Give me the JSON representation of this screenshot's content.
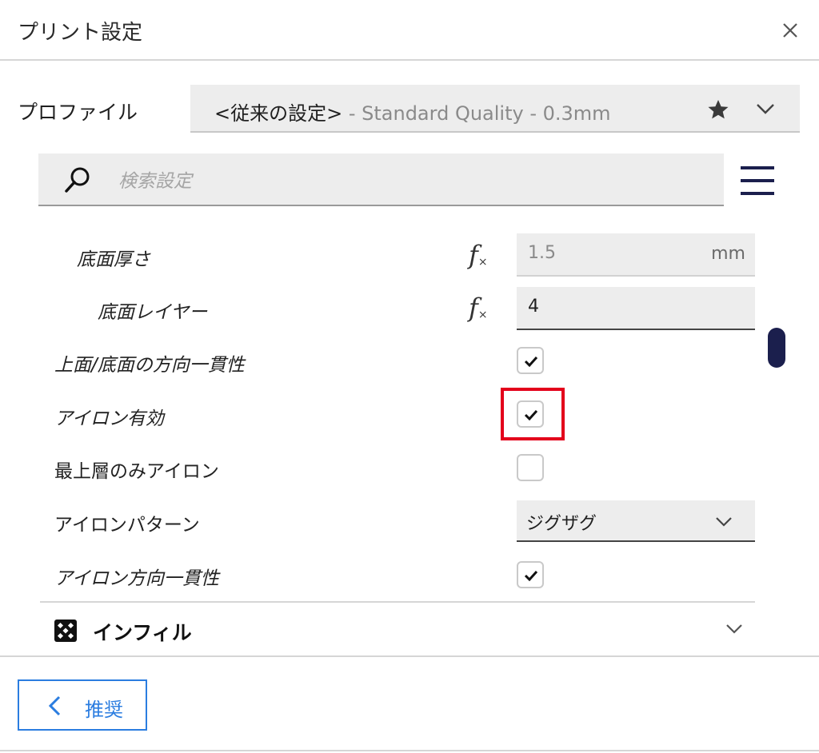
{
  "dialog": {
    "title": "プリント設定",
    "close_icon": "close-icon"
  },
  "profile": {
    "label": "プロファイル",
    "value_main": "<従来の設定>",
    "value_sub": " - Standard Quality - 0.3mm",
    "star_icon": "star-icon",
    "chevron_icon": "chevron-down-icon"
  },
  "search": {
    "placeholder": "検索設定",
    "icon": "search-icon",
    "menu_icon": "menu-icon"
  },
  "settings": {
    "bottom_thickness": {
      "label": "底面厚さ",
      "fx": "f",
      "value": "1.5",
      "unit": "mm"
    },
    "bottom_layers": {
      "label": "底面レイヤー",
      "fx": "f",
      "value": "4"
    },
    "top_bottom_consistent": {
      "label": "上面/底面の方向一貫性",
      "checked": true
    },
    "ironing_enabled": {
      "label": "アイロン有効",
      "checked": true
    },
    "iron_top_only": {
      "label": "最上層のみアイロン",
      "checked": false
    },
    "ironing_pattern": {
      "label": "アイロンパターン",
      "value": "ジグザグ"
    },
    "ironing_consistent": {
      "label": "アイロン方向一貫性",
      "checked": true
    }
  },
  "infill": {
    "label": "インフィル",
    "icon": "infill-icon"
  },
  "footer": {
    "recommend_label": "推奨",
    "chevron_icon": "chevron-left-icon"
  },
  "colors": {
    "accent_blue": "#2b7de0",
    "highlight_red": "#e3001b",
    "scrollbar": "#1b1f4d"
  }
}
